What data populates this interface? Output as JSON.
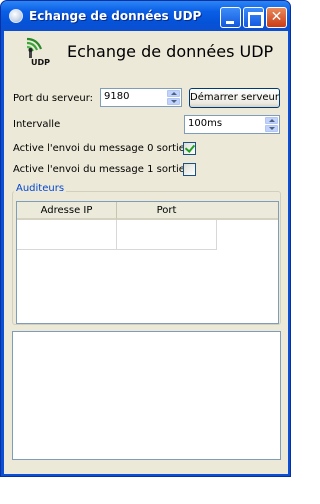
{
  "window": {
    "title": "Echange de données UDP"
  },
  "header": {
    "icon_name": "wifi-signal-icon",
    "icon_caption": "UDP",
    "heading": "Echange de données UDP"
  },
  "form": {
    "port_label": "Port du serveur:",
    "port_value": "9180",
    "start_button": "Démarrer serveur",
    "interval_label": "Intervalle",
    "interval_value": "100ms",
    "msg0_label": "Active l'envoi du message 0 sortie",
    "msg0_checked": true,
    "msg1_label": "Active l'envoi du message 1 sortie",
    "msg1_checked": false
  },
  "listeners": {
    "group_title": "Auditeurs",
    "columns": [
      "Adresse IP",
      "Port"
    ]
  },
  "colors": {
    "titlebar": "#0a5ee6",
    "close_button": "#cc3b14",
    "group_title": "#0046d5",
    "check_mark": "#21a121"
  }
}
